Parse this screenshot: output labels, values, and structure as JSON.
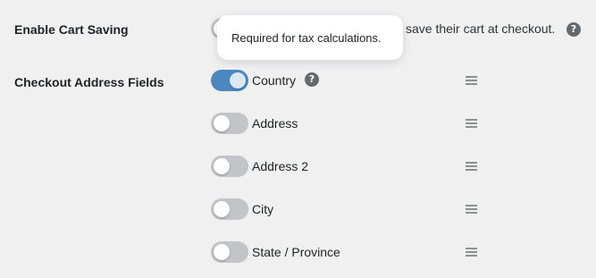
{
  "cart_saving": {
    "label": "Enable Cart Saving",
    "description": "save their cart at checkout.",
    "help_icon": "?",
    "enabled": false
  },
  "tooltip": {
    "text": "Required for tax calculations."
  },
  "address_fields": {
    "label": "Checkout Address Fields",
    "help_icon": "?",
    "items": [
      {
        "label": "Country",
        "enabled": true
      },
      {
        "label": "Address",
        "enabled": false
      },
      {
        "label": "Address 2",
        "enabled": false
      },
      {
        "label": "City",
        "enabled": false
      },
      {
        "label": "State / Province",
        "enabled": false
      }
    ]
  },
  "colors": {
    "toggle_on": "#4c87bf",
    "toggle_off": "#c3c4c7",
    "background": "#f0f0f1"
  }
}
